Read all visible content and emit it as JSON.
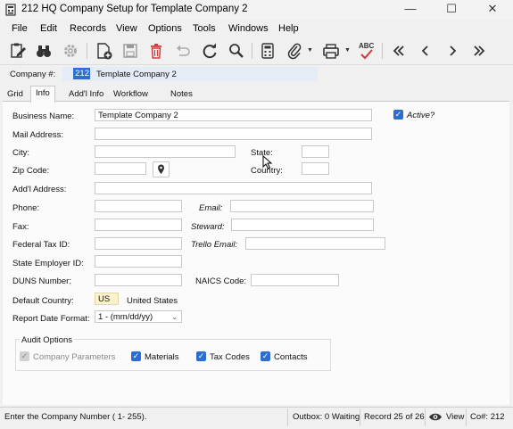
{
  "window": {
    "title": "212 HQ Company Setup for Template Company 2",
    "controls": [
      "minimize",
      "maximize",
      "close"
    ]
  },
  "menu": [
    "File",
    "Edit",
    "Records",
    "View",
    "Options",
    "Tools",
    "Windows",
    "Help"
  ],
  "toolbar": {
    "items": [
      "edit-icon",
      "binoculars-icon",
      "gear-icon",
      "new-record-icon",
      "save-icon",
      "delete-icon",
      "undo-icon",
      "refresh-icon",
      "search-icon",
      "calculator-icon",
      "attachment-icon",
      "print-icon",
      "spellcheck-icon",
      "first-record-icon",
      "previous-record-icon",
      "next-record-icon",
      "last-record-icon"
    ],
    "spell_text": "ABC"
  },
  "company": {
    "label": "Company #:",
    "number": "212",
    "name": "Template Company 2"
  },
  "tabs": [
    "Grid",
    "Info",
    "Add'l Info",
    "Workflow",
    "Notes"
  ],
  "active_tab": "Info",
  "form": {
    "business_name": {
      "label": "Business Name:",
      "value": "Template Company 2"
    },
    "active": {
      "label": "Active?",
      "checked": true
    },
    "mail_address": {
      "label": "Mail Address:",
      "value": ""
    },
    "city": {
      "label": "City:",
      "value": ""
    },
    "state": {
      "label": "State:",
      "value": ""
    },
    "zip": {
      "label": "Zip Code:",
      "value": ""
    },
    "country": {
      "label": "Country:",
      "value": ""
    },
    "addl_address": {
      "label": "Add'l Address:",
      "value": ""
    },
    "phone": {
      "label": "Phone:",
      "value": ""
    },
    "email": {
      "label": "Email:",
      "value": ""
    },
    "fax": {
      "label": "Fax:",
      "value": ""
    },
    "steward": {
      "label": "Steward:",
      "value": ""
    },
    "federal_tax_id": {
      "label": "Federal Tax ID:",
      "value": ""
    },
    "trello_email": {
      "label": "Trello Email:",
      "value": ""
    },
    "state_employer_id": {
      "label": "State Employer ID:",
      "value": ""
    },
    "duns": {
      "label": "DUNS Number:",
      "value": ""
    },
    "naics": {
      "label": "NAICS Code:",
      "value": ""
    },
    "default_country": {
      "label": "Default Country:",
      "code": "US",
      "name": "United States"
    },
    "report_date_format": {
      "label": "Report Date Format:",
      "value": "1 - (mm/dd/yy)"
    }
  },
  "audit": {
    "title": "Audit Options",
    "options": [
      {
        "label": "Company Parameters",
        "checked": true,
        "disabled": true
      },
      {
        "label": "Materials",
        "checked": true,
        "disabled": false
      },
      {
        "label": "Tax Codes",
        "checked": true,
        "disabled": false
      },
      {
        "label": "Contacts",
        "checked": true,
        "disabled": false
      }
    ]
  },
  "status": {
    "message": "Enter the Company Number ( 1- 255).",
    "outbox": "Outbox: 0 Waiting",
    "record": "Record 25 of 26",
    "view": "View",
    "co": "Co#: 212"
  },
  "colors": {
    "accent": "#2c6dd2",
    "delete": "#d23a3a",
    "selection": "#2f6fd5"
  }
}
